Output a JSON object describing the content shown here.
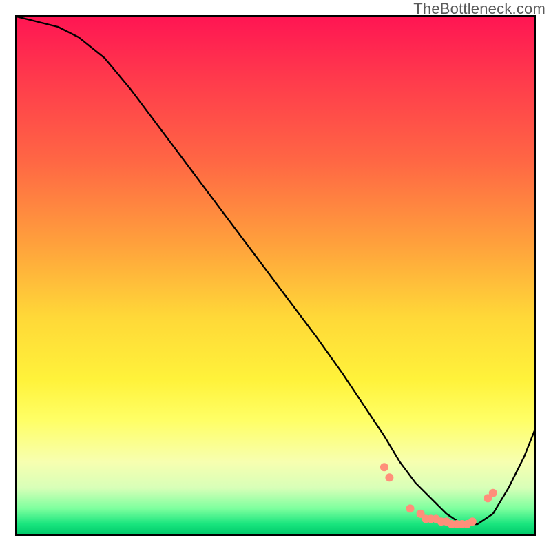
{
  "watermark": "TheBottleneck.com",
  "chart_data": {
    "type": "line",
    "title": "",
    "xlabel": "",
    "ylabel": "",
    "xlim": [
      0,
      100
    ],
    "ylim": [
      0,
      100
    ],
    "grid": false,
    "background_gradient": [
      {
        "pos": 0,
        "color": "#ff1553"
      },
      {
        "pos": 12,
        "color": "#ff3a4c"
      },
      {
        "pos": 28,
        "color": "#ff6744"
      },
      {
        "pos": 44,
        "color": "#ffa13c"
      },
      {
        "pos": 58,
        "color": "#ffd838"
      },
      {
        "pos": 70,
        "color": "#fff23a"
      },
      {
        "pos": 78,
        "color": "#ffff66"
      },
      {
        "pos": 86,
        "color": "#f7ffb0"
      },
      {
        "pos": 91,
        "color": "#d8ffb8"
      },
      {
        "pos": 95,
        "color": "#7dff9e"
      },
      {
        "pos": 98,
        "color": "#19e57e"
      },
      {
        "pos": 100,
        "color": "#00c96a"
      }
    ],
    "series": [
      {
        "name": "bottleneck-curve",
        "color": "#000000",
        "x": [
          0,
          4,
          8,
          12,
          17,
          22,
          28,
          34,
          40,
          46,
          52,
          58,
          63,
          67,
          71,
          74,
          77,
          80,
          83,
          86,
          89,
          92,
          95,
          98,
          100
        ],
        "y": [
          100,
          99,
          98,
          96,
          92,
          86,
          78,
          70,
          62,
          54,
          46,
          38,
          31,
          25,
          19,
          14,
          10,
          7,
          4,
          2,
          2,
          4,
          9,
          15,
          20
        ]
      }
    ],
    "markers": {
      "name": "highlight-points",
      "color": "#ff8f7a",
      "radius": 6,
      "points": [
        {
          "x": 71,
          "y": 13
        },
        {
          "x": 72,
          "y": 11
        },
        {
          "x": 76,
          "y": 5
        },
        {
          "x": 78,
          "y": 4
        },
        {
          "x": 79,
          "y": 3
        },
        {
          "x": 80,
          "y": 3
        },
        {
          "x": 81,
          "y": 3
        },
        {
          "x": 82,
          "y": 2.5
        },
        {
          "x": 83,
          "y": 2.5
        },
        {
          "x": 84,
          "y": 2
        },
        {
          "x": 85,
          "y": 2
        },
        {
          "x": 86,
          "y": 2
        },
        {
          "x": 87,
          "y": 2
        },
        {
          "x": 88,
          "y": 2.5
        },
        {
          "x": 91,
          "y": 7
        },
        {
          "x": 92,
          "y": 8
        }
      ]
    }
  }
}
